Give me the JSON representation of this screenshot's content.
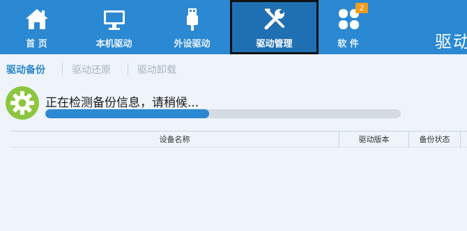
{
  "nav": {
    "items": [
      {
        "label": "首 页",
        "icon": "home-icon"
      },
      {
        "label": "本机驱动",
        "icon": "monitor-icon"
      },
      {
        "label": "外设驱动",
        "icon": "usb-icon"
      },
      {
        "label": "驱动管理",
        "icon": "tools-icon",
        "active": true
      },
      {
        "label": "软 件",
        "icon": "clover-icon",
        "badge": "2"
      }
    ],
    "brand_partial": "驱动"
  },
  "subtabs": [
    {
      "label": "驱动备份",
      "active": true
    },
    {
      "label": "驱动还原"
    },
    {
      "label": "驱动卸载"
    }
  ],
  "scan": {
    "status_text": "正在检测备份信息，请稍候...",
    "progress_percent": 46,
    "icon": "gear-icon"
  },
  "table": {
    "columns": [
      "设备名称",
      "驱动版本",
      "备份状态"
    ]
  },
  "colors": {
    "topbar": "#2b89d3",
    "active_tab": "#1f6fb3",
    "accent_green": "#8cc63f",
    "progress": "#2b89d3",
    "badge": "#f29c1c"
  }
}
